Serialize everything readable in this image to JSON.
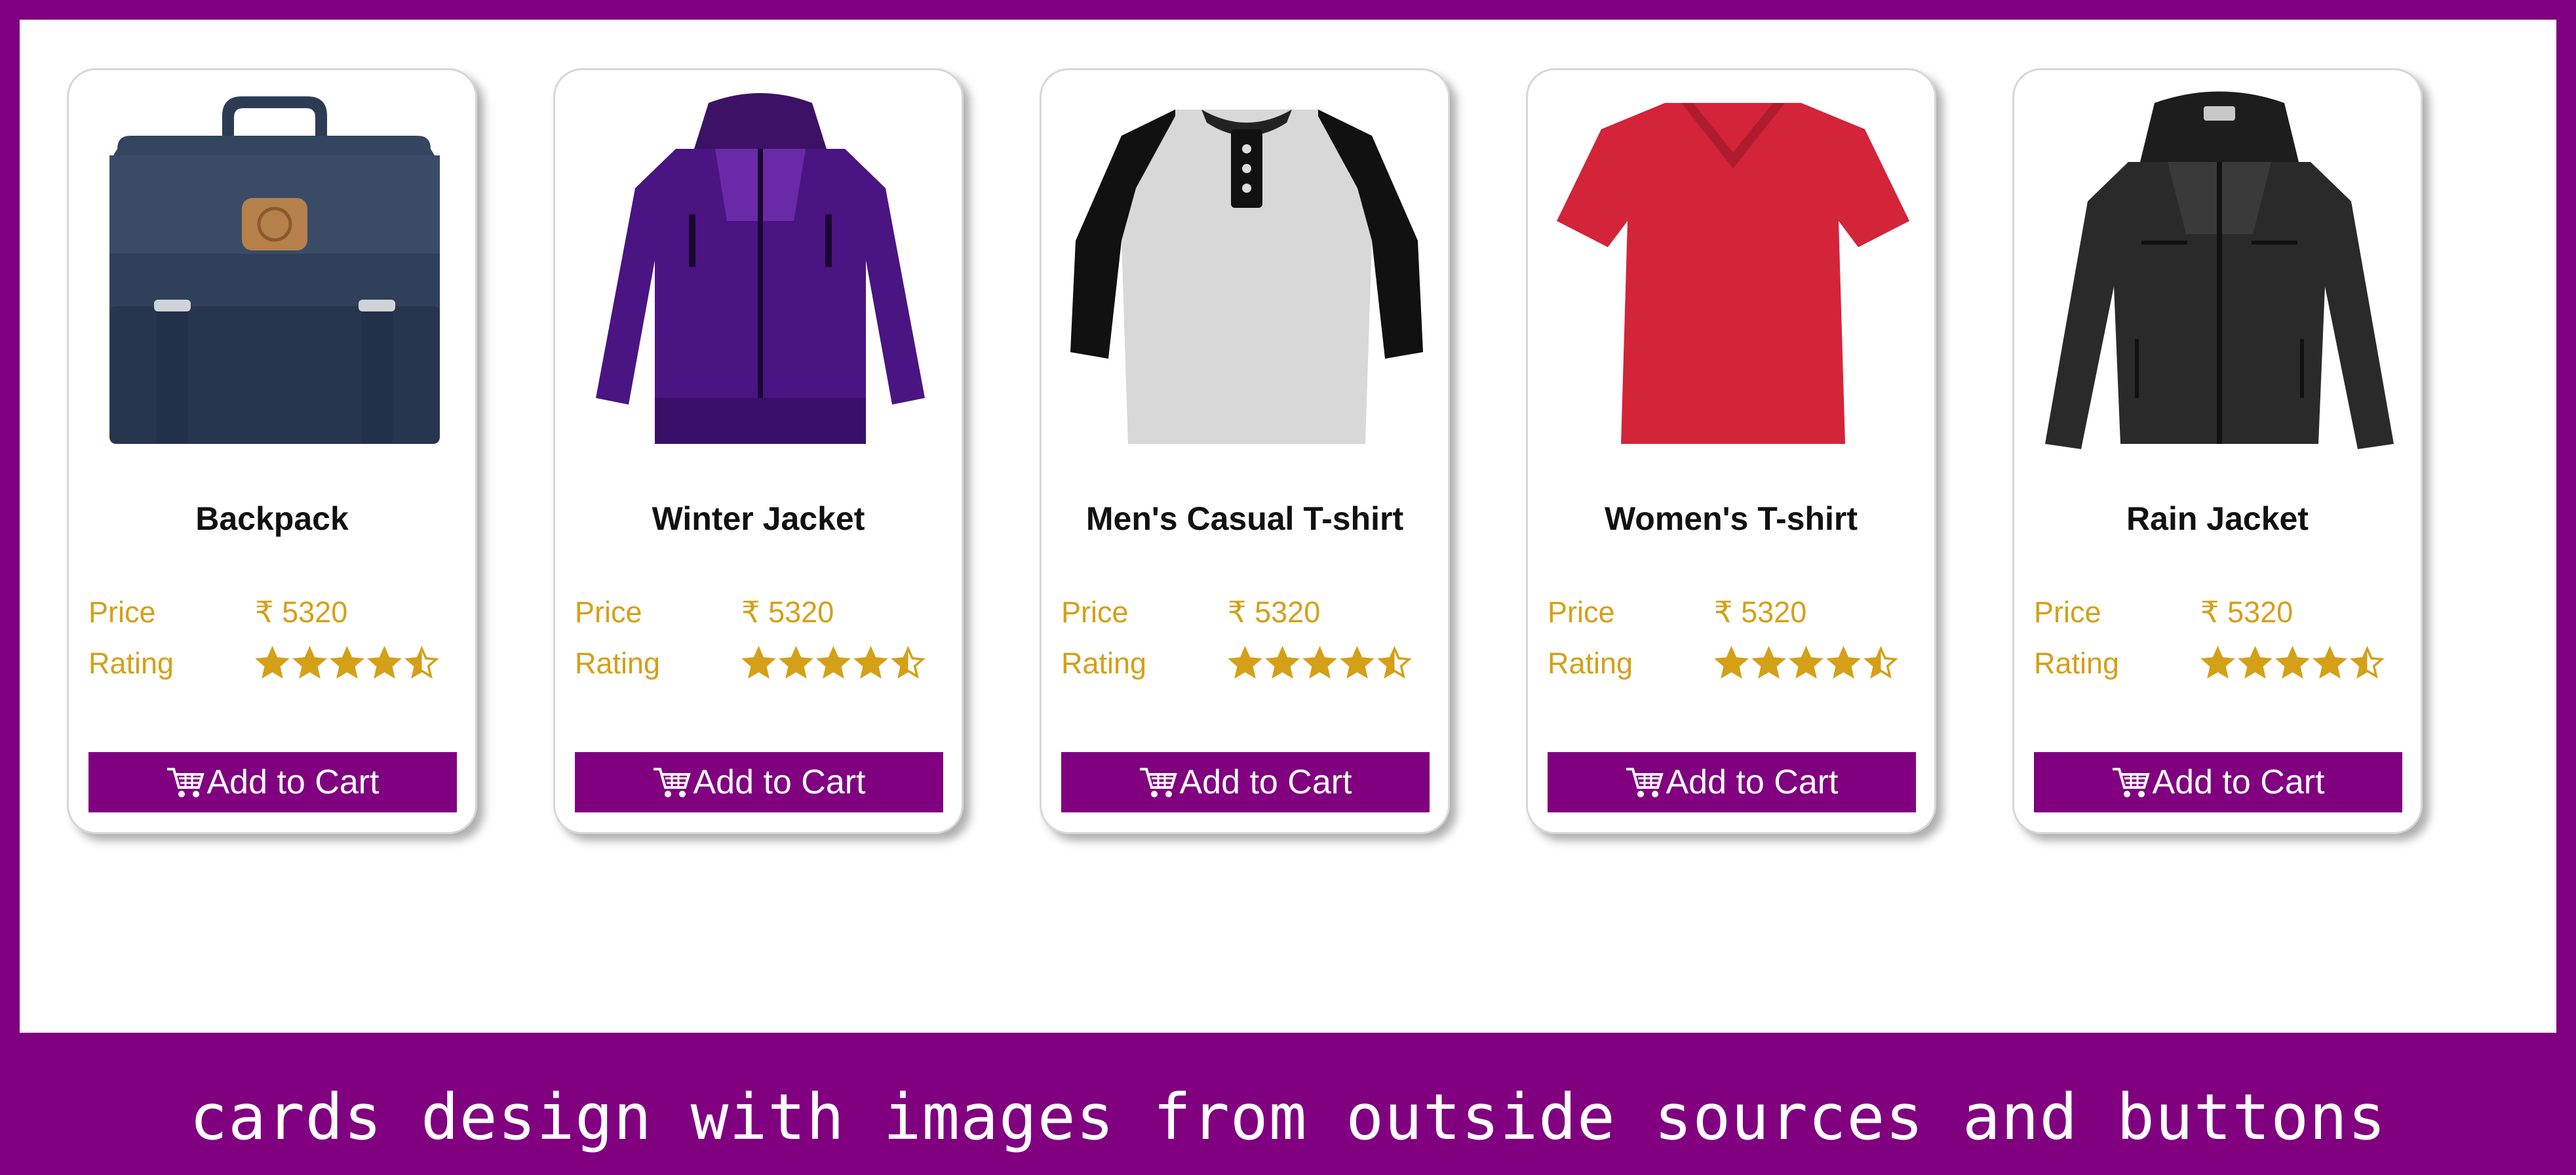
{
  "colors": {
    "accent": "#800080",
    "gold": "#d4a017",
    "card_border": "#d7d7d7"
  },
  "cards": [
    {
      "title": "Backpack",
      "image_icon": "backpack",
      "price_label": "Price",
      "price_value": "₹ 5320",
      "rating_label": "Rating",
      "rating": 4.5,
      "button_label": "Add to Cart"
    },
    {
      "title": "Winter Jacket",
      "image_icon": "winter-jacket",
      "price_label": "Price",
      "price_value": "₹ 5320",
      "rating_label": "Rating",
      "rating": 4.5,
      "button_label": "Add to Cart"
    },
    {
      "title": "Men's Casual T-shirt",
      "image_icon": "mens-tshirt",
      "price_label": "Price",
      "price_value": "₹ 5320",
      "rating_label": "Rating",
      "rating": 4.5,
      "button_label": "Add to Cart"
    },
    {
      "title": "Women's T-shirt",
      "image_icon": "womens-tshirt",
      "price_label": "Price",
      "price_value": "₹ 5320",
      "rating_label": "Rating",
      "rating": 4.5,
      "button_label": "Add to Cart"
    },
    {
      "title": "Rain Jacket",
      "image_icon": "rain-jacket",
      "price_label": "Price",
      "price_value": "₹ 5320",
      "rating_label": "Rating",
      "rating": 4.5,
      "button_label": "Add to Cart"
    }
  ],
  "footer": {
    "caption": "cards design with images from outside sources and buttons"
  }
}
